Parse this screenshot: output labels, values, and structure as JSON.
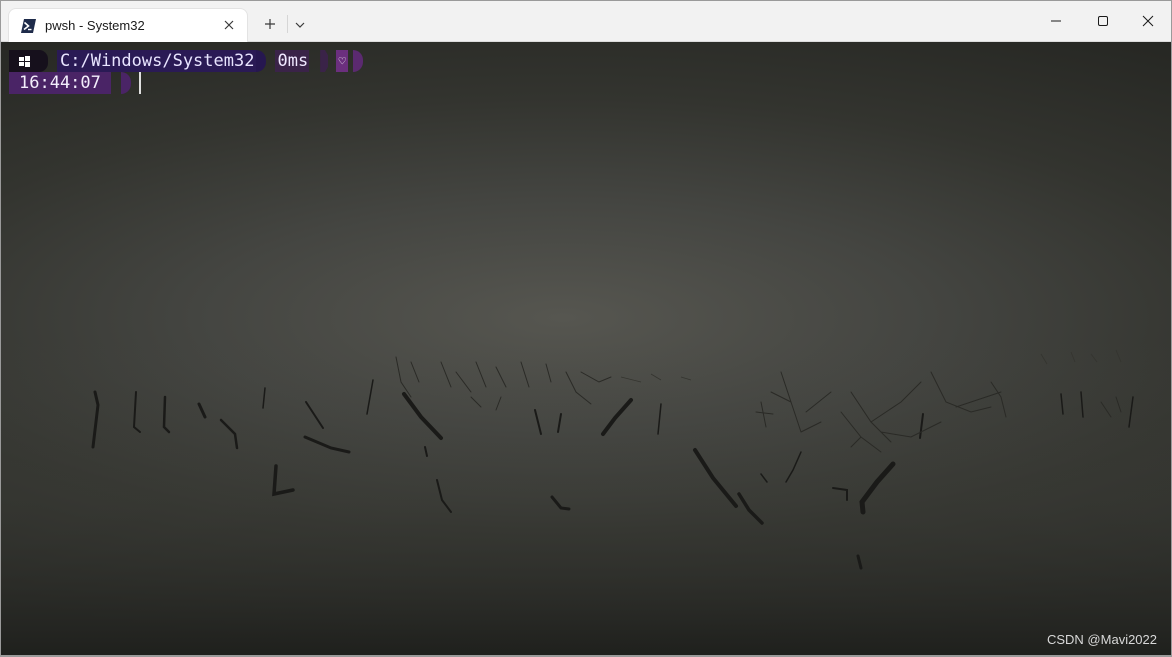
{
  "tab": {
    "title": "pwsh - System32",
    "icon": "powershell-icon",
    "close_icon": "close-icon"
  },
  "tabbar": {
    "new_tab_icon": "plus-icon",
    "dropdown_icon": "chevron-down-icon"
  },
  "window_controls": [
    "minimize-icon",
    "maximize-icon",
    "close-icon"
  ],
  "prompt": {
    "os_icon": "windows-icon",
    "path": "C:/Windows/System32",
    "exec_time": "0ms",
    "status_glyph": "♡",
    "time": "16:44:07"
  },
  "watermark": "CSDN @Mavi2022",
  "colors": {
    "path_segment": "#2a1a55",
    "exec_segment": "#3a2348",
    "time_segment": "#4a2466",
    "heart_segment": "#6b2f7e"
  }
}
